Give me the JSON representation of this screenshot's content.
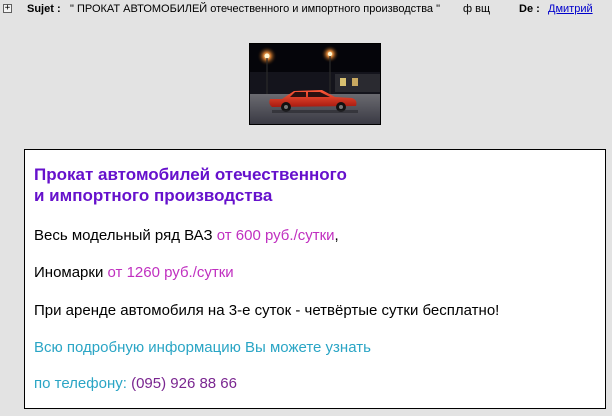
{
  "header": {
    "expand_symbol": "+",
    "subject_label": "Sujet :",
    "subject_text": "\" ПРОКАТ АВТОМОБИЛЕЙ отечественного и импортного производства \"",
    "code": "ф вщ",
    "author_label": "De :",
    "author_name": "Дмитрий"
  },
  "ad": {
    "title_line1": "Прокат автомобилей отечественного",
    "title_line2": "и импортного производства",
    "vaz_text": "Весь модельный ряд ВАЗ ",
    "vaz_price": "от 600 руб./сутки",
    "vaz_suffix": ",",
    "foreign_text": "Иномарки ",
    "foreign_price": "от 1260 руб./сутки",
    "promo": "При аренде автомобиля на 3-е суток - четвёртые сутки бесплатно!",
    "info": "Всю подробную информацию Вы можете узнать",
    "phone_label": "по телефону: ",
    "phone_number": " (095) 926 88 66"
  },
  "colors": {
    "title": "#6611cc",
    "price": "#c030c0",
    "info": "#2aa5c5",
    "phone": "#7a2590",
    "link": "#0000cc"
  },
  "icons": {
    "expand": "plus-box-icon",
    "picture": "red-car-night-street"
  }
}
